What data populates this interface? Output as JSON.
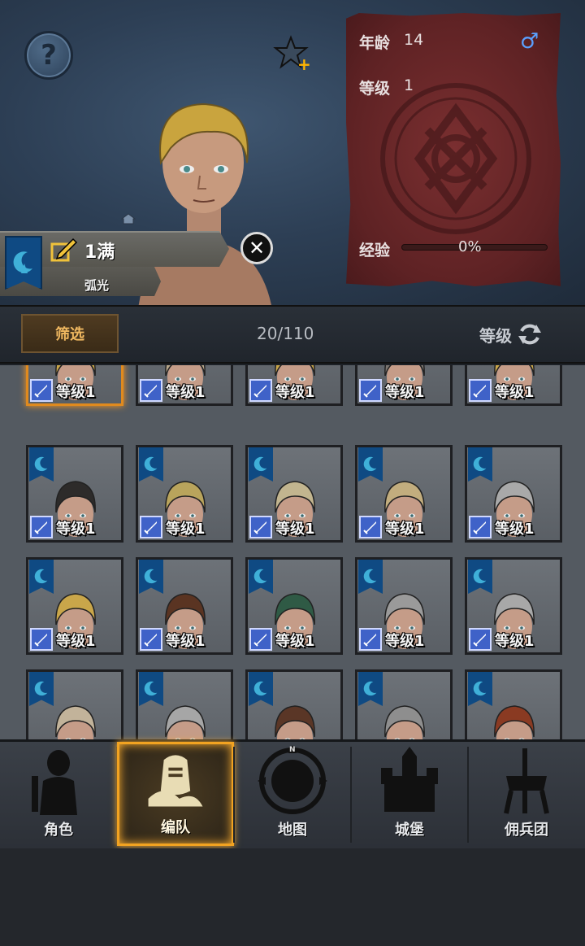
{
  "hero": {
    "help_icon": "question-icon",
    "favorite_icon": "star-plus-icon",
    "character": {
      "name": "1满",
      "class": "弧光",
      "remove_icon": "close-icon"
    },
    "stats": {
      "age_label": "年龄",
      "age_value": "14",
      "level_label": "等级",
      "level_value": "1",
      "exp_label": "经验",
      "exp_percent": "0%",
      "exp_fraction": 0,
      "gender_icon": "♂"
    }
  },
  "filter_bar": {
    "filter_label": "筛选",
    "count": "20/110",
    "sort_label": "等级"
  },
  "grid": {
    "level_text": "等级1",
    "hair_colors": [
      "#c9a64a",
      "#b7a68a",
      "#c9a64a",
      "#7a7570",
      "#c9a64a",
      "#2d2b2a",
      "#b9a45c",
      "#c2b58f",
      "#c2ad7e",
      "#a9a9a9",
      "#c9a64a",
      "#5a3422",
      "#2f5a45",
      "#9a9a9a",
      "#a8a8a8",
      "#c2b39a",
      "#a6a6a6",
      "#5a3626",
      "#8e8e8e",
      "#8a3a22"
    ]
  },
  "nav": {
    "items": [
      {
        "label": "角色",
        "icon": "knight-icon"
      },
      {
        "label": "编队",
        "icon": "helmet-icon"
      },
      {
        "label": "地图",
        "icon": "compass-icon"
      },
      {
        "label": "城堡",
        "icon": "castle-icon"
      },
      {
        "label": "佣兵团",
        "icon": "banner-icon"
      }
    ]
  },
  "colors": {
    "accent": "#f2a321",
    "class_blue": "#0f4a83",
    "stats_red": "#6a2628"
  }
}
